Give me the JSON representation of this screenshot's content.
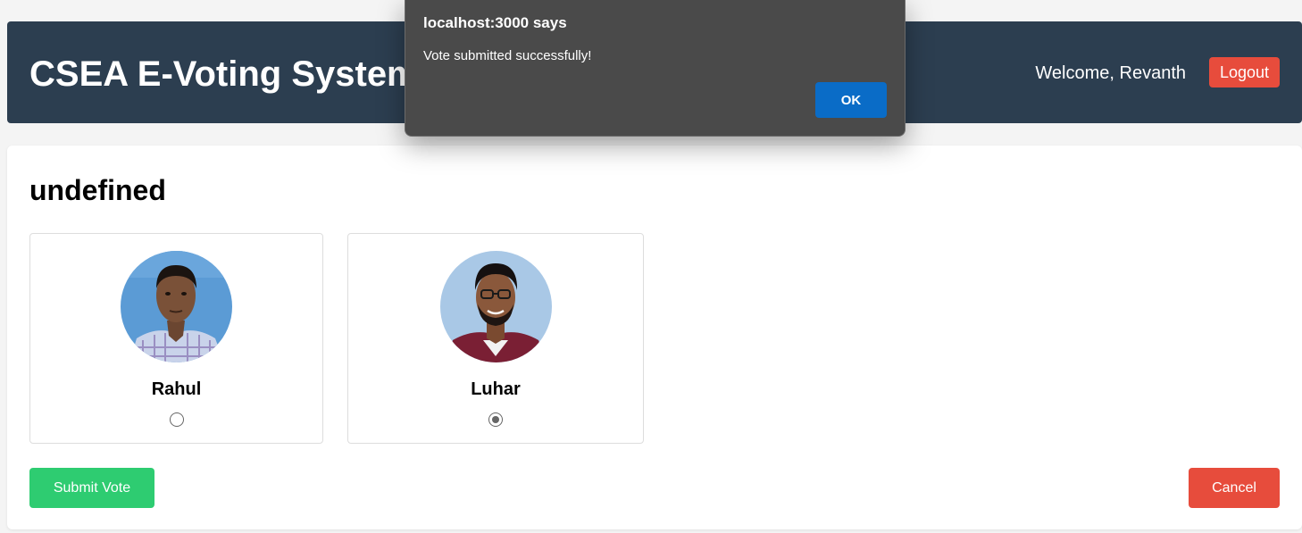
{
  "header": {
    "title": "CSEA E-Voting System",
    "welcome_text": "Welcome, Revanth",
    "logout_label": "Logout"
  },
  "election": {
    "title": "undefined",
    "candidates": [
      {
        "name": "Rahul",
        "selected": false
      },
      {
        "name": "Luhar",
        "selected": true
      }
    ]
  },
  "actions": {
    "submit_label": "Submit Vote",
    "cancel_label": "Cancel"
  },
  "dialog": {
    "title": "localhost:3000 says",
    "message": "Vote submitted successfully!",
    "ok_label": "OK"
  },
  "colors": {
    "header_bg": "#2c3e50",
    "danger": "#e74c3c",
    "success": "#2ecc71",
    "dialog_bg": "#4a4a4a",
    "dialog_button": "#0a6cc7"
  }
}
